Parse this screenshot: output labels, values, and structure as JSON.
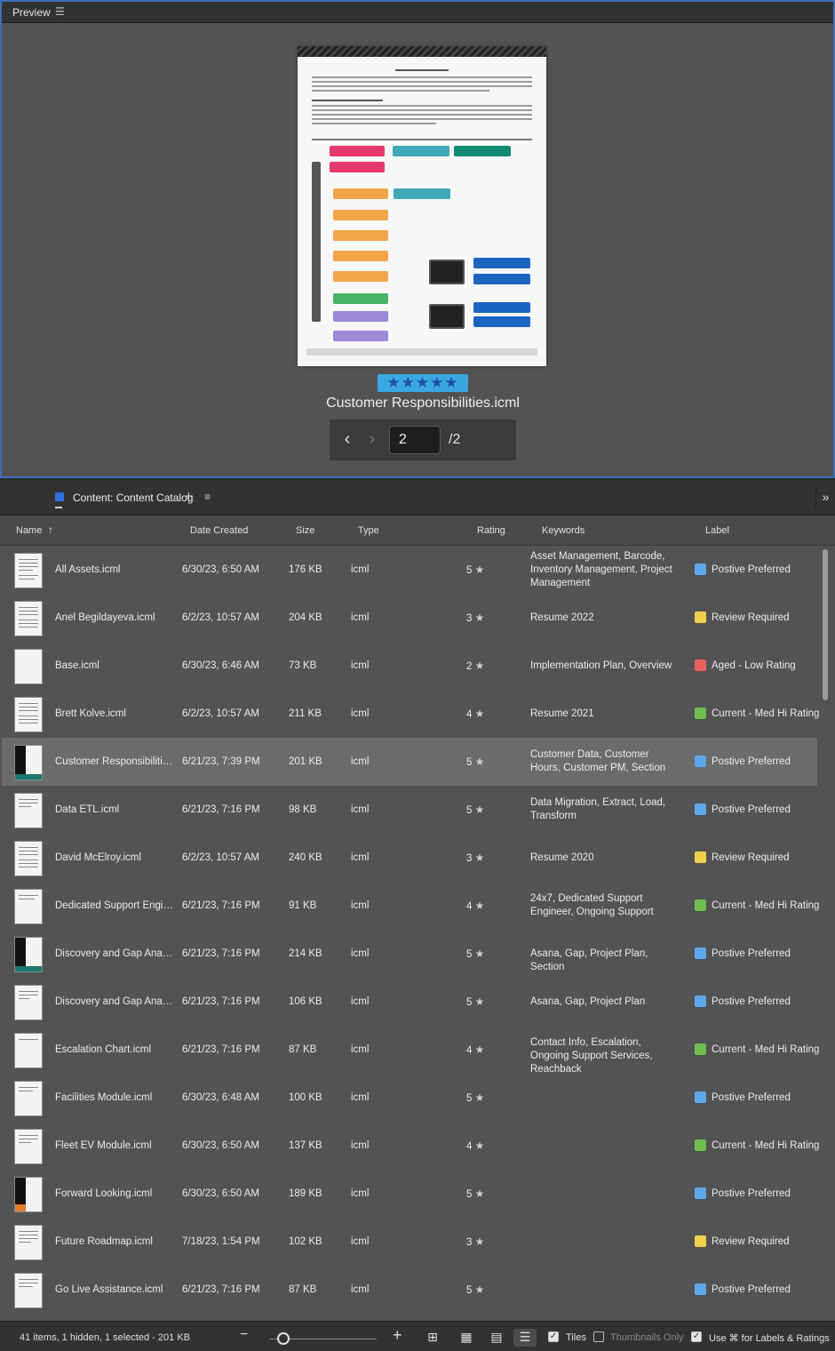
{
  "preview": {
    "title": "Preview",
    "menu_icon": "hamburger-icon",
    "rating_stars": "★★★★★",
    "filename": "Customer Responsibilities.icml",
    "pager": {
      "prev": "‹",
      "next": "›",
      "current": "2",
      "total": "/2"
    }
  },
  "content": {
    "tab_label": "Content: Content Catalog",
    "tab_add": "+",
    "menu": "≡",
    "expand": "»",
    "columns": {
      "name": "Name",
      "date": "Date Created",
      "size": "Size",
      "type": "Type",
      "rating": "Rating",
      "keywords": "Keywords",
      "label": "Label"
    },
    "sort_icon": "↑",
    "colors": {
      "blue": "#5aa7ee",
      "yellow": "#f1cf4a",
      "red": "#e9625c",
      "green": "#6cbf4f"
    },
    "rows": [
      {
        "name": "All Assets.icml",
        "date": "6/30/23, 6:50 AM",
        "size": "176 KB",
        "type": "icml",
        "rating": "5",
        "keywords": "Asset Management, Barcode, Inventory Management, Project Management",
        "label": "Postive Preferred",
        "color": "#5aa7ee"
      },
      {
        "name": "Anel Begildayeva.icml",
        "date": "6/2/23, 10:57 AM",
        "size": "204 KB",
        "type": "icml",
        "rating": "3",
        "keywords": "Resume 2022",
        "label": "Review Required",
        "color": "#f1cf4a"
      },
      {
        "name": "Base.icml",
        "date": "6/30/23, 6:46 AM",
        "size": "73 KB",
        "type": "icml",
        "rating": "2",
        "keywords": "Implementation Plan, Overview",
        "label": "Aged - Low Rating",
        "color": "#e9625c"
      },
      {
        "name": "Brett Kolve.icml",
        "date": "6/2/23, 10:57 AM",
        "size": "211 KB",
        "type": "icml",
        "rating": "4",
        "keywords": "Resume 2021",
        "label": "Current - Med Hi Rating",
        "color": "#6cbf4f"
      },
      {
        "name": "Customer Responsibilities.icml",
        "date": "6/21/23, 7:39 PM",
        "size": "201 KB",
        "type": "icml",
        "rating": "5",
        "keywords": "Customer Data, Customer Hours, Customer PM, Section",
        "label": "Postive Preferred",
        "color": "#5aa7ee"
      },
      {
        "name": "Data ETL.icml",
        "date": "6/21/23, 7:16 PM",
        "size": "98 KB",
        "type": "icml",
        "rating": "5",
        "keywords": "Data Migration, Extract, Load, Transform",
        "label": "Postive Preferred",
        "color": "#5aa7ee"
      },
      {
        "name": "David McElroy.icml",
        "date": "6/2/23, 10:57 AM",
        "size": "240 KB",
        "type": "icml",
        "rating": "3",
        "keywords": "Resume 2020",
        "label": "Review Required",
        "color": "#f1cf4a"
      },
      {
        "name": "Dedicated Support Engineer.icml",
        "date": "6/21/23, 7:16 PM",
        "size": "91 KB",
        "type": "icml",
        "rating": "4",
        "keywords": "24x7, Dedicated Support Engineer, Ongoing Support",
        "label": "Current - Med Hi Rating",
        "color": "#6cbf4f"
      },
      {
        "name": "Discovery and Gap Anaysis.icml",
        "date": "6/21/23, 7:16 PM",
        "size": "214 KB",
        "type": "icml",
        "rating": "5",
        "keywords": "Asana, Gap, Project Plan, Section",
        "label": "Postive Preferred",
        "color": "#5aa7ee"
      },
      {
        "name": "Discovery and Gap Anaysis.icml",
        "date": "6/21/23, 7:16 PM",
        "size": "106 KB",
        "type": "icml",
        "rating": "5",
        "keywords": "Asana, Gap, Project Plan",
        "label": "Postive Preferred",
        "color": "#5aa7ee"
      },
      {
        "name": "Escalation Chart.icml",
        "date": "6/21/23, 7:16 PM",
        "size": "87 KB",
        "type": "icml",
        "rating": "4",
        "keywords": "Contact Info, Escalation, Ongoing Support Services, Reachback",
        "label": "Current - Med Hi Rating",
        "color": "#6cbf4f"
      },
      {
        "name": "Facilities Module.icml",
        "date": "6/30/23, 6:48 AM",
        "size": "100 KB",
        "type": "icml",
        "rating": "5",
        "keywords": "",
        "label": "Postive Preferred",
        "color": "#5aa7ee"
      },
      {
        "name": "Fleet EV Module.icml",
        "date": "6/30/23, 6:50 AM",
        "size": "137 KB",
        "type": "icml",
        "rating": "4",
        "keywords": "",
        "label": "Current - Med Hi Rating",
        "color": "#6cbf4f"
      },
      {
        "name": "Forward Looking.icml",
        "date": "6/30/23, 6:50 AM",
        "size": "189 KB",
        "type": "icml",
        "rating": "5",
        "keywords": "",
        "label": "Postive Preferred",
        "color": "#5aa7ee"
      },
      {
        "name": "Future Roadmap.icml",
        "date": "7/18/23, 1:54 PM",
        "size": "102 KB",
        "type": "icml",
        "rating": "3",
        "keywords": "",
        "label": "Review Required",
        "color": "#f1cf4a"
      },
      {
        "name": "Go Live Assistance.icml",
        "date": "6/21/23, 7:16 PM",
        "size": "87 KB",
        "type": "icml",
        "rating": "5",
        "keywords": "",
        "label": "Postive Preferred",
        "color": "#5aa7ee"
      }
    ]
  },
  "status": {
    "summary": "41 items, 1 hidden, 1 selected - 201 KB",
    "zoom_minus": "−",
    "zoom_plus": "+",
    "tiles_label": "Tiles",
    "thumbnails_only_label": "Thumbnails Only",
    "use_cmd_label": "Use ⌘ for Labels & Ratings"
  }
}
